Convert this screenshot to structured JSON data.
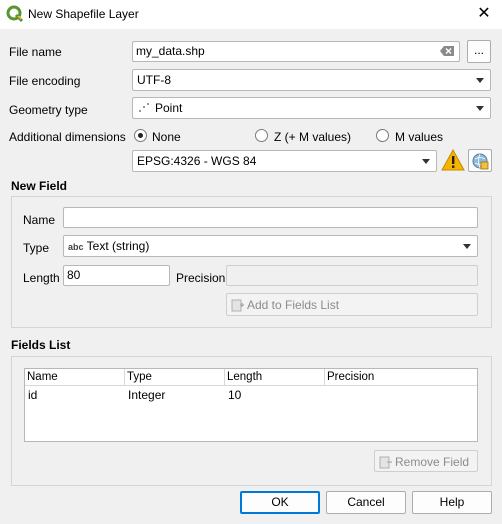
{
  "window": {
    "title": "New Shapefile Layer",
    "close": "✕"
  },
  "form": {
    "file_name_label": "File name",
    "file_name_value": "my_data.shp",
    "browse_label": "...",
    "file_encoding_label": "File encoding",
    "file_encoding_value": "UTF-8",
    "geometry_type_label": "Geometry type",
    "geometry_type_value": "Point",
    "additional_dimensions_label": "Additional dimensions",
    "dimensions_options": [
      {
        "label": "None",
        "selected": true
      },
      {
        "label": "Z (+ M values)",
        "selected": false
      },
      {
        "label": "M values",
        "selected": false
      }
    ],
    "crs_value": "EPSG:4326 - WGS 84"
  },
  "new_field": {
    "title": "New Field",
    "name_label": "Name",
    "name_value": "",
    "type_label": "Type",
    "type_icon_text": "abc",
    "type_value": "Text (string)",
    "length_label": "Length",
    "length_value": "80",
    "precision_label": "Precision",
    "precision_value": "",
    "add_button_label": "Add to Fields List"
  },
  "fields_list": {
    "title": "Fields List",
    "columns": [
      "Name",
      "Type",
      "Length",
      "Precision"
    ],
    "rows": [
      [
        "id",
        "Integer",
        "10",
        ""
      ]
    ],
    "remove_button_label": "Remove Field"
  },
  "buttons": {
    "ok": "OK",
    "cancel": "Cancel",
    "help": "Help"
  },
  "colors": {
    "accent": "#0078d7",
    "warning": "#f4b400",
    "qgis_green": "#589632"
  }
}
